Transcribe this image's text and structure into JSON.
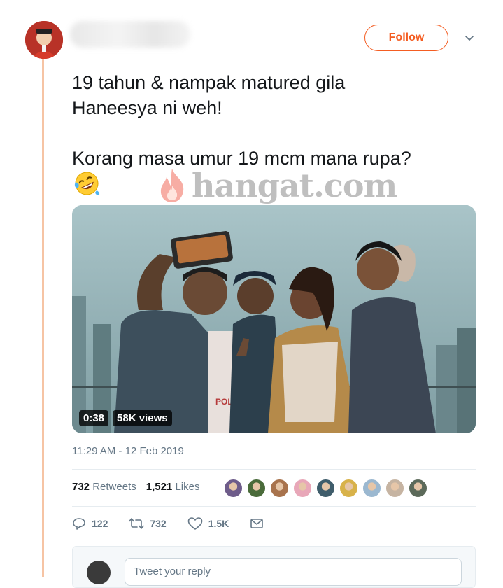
{
  "tweet": {
    "follow_label": "Follow",
    "text": "19 tahun & nampak matured gila\nHaneesya ni weh!\n\nKorang masa umur 19 mcm mana rupa?",
    "emoji_icon": "rolling-on-floor-laughing-emoji",
    "watermark_text": "hangat.com",
    "video": {
      "duration": "0:38",
      "views": "58K views"
    },
    "timestamp": "11:29 AM - 12 Feb 2019",
    "stats": {
      "retweets_count": "732",
      "retweets_label": "Retweets",
      "likes_count": "1,521",
      "likes_label": "Likes"
    },
    "likers": [
      "#6e5c8a",
      "#4a6b3a",
      "#a8734d",
      "#e8a7b8",
      "#3f5d6b",
      "#d8b24a",
      "#9bb8d0",
      "#c6b4a2",
      "#5c6a5a"
    ],
    "actions": {
      "reply_count": "122",
      "retweet_count": "732",
      "like_count": "1.5K"
    },
    "reply_placeholder": "Tweet your reply"
  },
  "colors": {
    "accent": "#f45d22",
    "thread_line": "#f6c4a4",
    "muted_text": "#657786"
  }
}
